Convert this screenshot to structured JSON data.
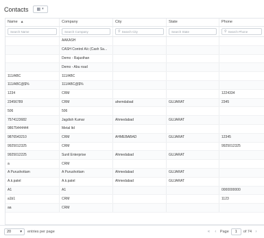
{
  "header": {
    "title": "Contacts",
    "view_icon": "grid-icon"
  },
  "columns": [
    "Name",
    "Company",
    "City",
    "State",
    "Phone"
  ],
  "filters": [
    "Search Name",
    "Search Company",
    "Search City",
    "Search State",
    "Search Phone"
  ],
  "rows": [
    [
      "",
      "AAKASH",
      "",
      "",
      ""
    ],
    [
      "",
      "CASH Control A/c (Cash Sa...",
      "",
      "",
      ""
    ],
    [
      "",
      "Demo - Rajasthan",
      "",
      "",
      ""
    ],
    [
      "",
      "Demo - Abu road",
      "",
      "",
      ""
    ],
    [
      "111/ABC",
      "111/ABC",
      "",
      "",
      ""
    ],
    [
      "111/ABC@$%",
      "111/ABC@$%",
      "",
      "",
      ""
    ],
    [
      "1234",
      "CRM",
      "",
      "",
      "1224334"
    ],
    [
      "23456789",
      "CRM",
      "ahemdabad",
      "GUJARAT",
      "2345"
    ],
    [
      "506",
      "506",
      "",
      "",
      ""
    ],
    [
      "7574123682",
      "Jagdish Kumar",
      "Ahmedabad",
      "GUJARAT",
      ""
    ],
    [
      "98675444444",
      "Metal ltd",
      "",
      "",
      ""
    ],
    [
      "9876543210",
      "CRM",
      "AHMEBABAD",
      "GUJARAT",
      "12345"
    ],
    [
      "9925012325",
      "CRM",
      "",
      "",
      "9925012325"
    ],
    [
      "9925012225",
      "Sunil Enterprise",
      "Ahmedabad",
      "GUJARAT",
      ""
    ],
    [
      "a",
      "CRM",
      "",
      "",
      ""
    ],
    [
      "A Purushottam",
      "A Purushottam",
      "Ahmedabad",
      "GUJARAT",
      ""
    ],
    [
      "A.k.patel",
      "A.k.patel",
      "Ahmedabad",
      "GUJARAT",
      ""
    ],
    [
      "A1",
      "A1",
      "",
      "",
      "0000000000"
    ],
    [
      "a1b1",
      "CRM",
      "",
      "",
      "1123"
    ],
    [
      "aa",
      "CRM",
      "",
      "",
      ""
    ]
  ],
  "footer": {
    "page_size": "20",
    "entries_label": "entries per page",
    "page_label": "Page",
    "current_page": "1",
    "of_label": "of 74"
  }
}
